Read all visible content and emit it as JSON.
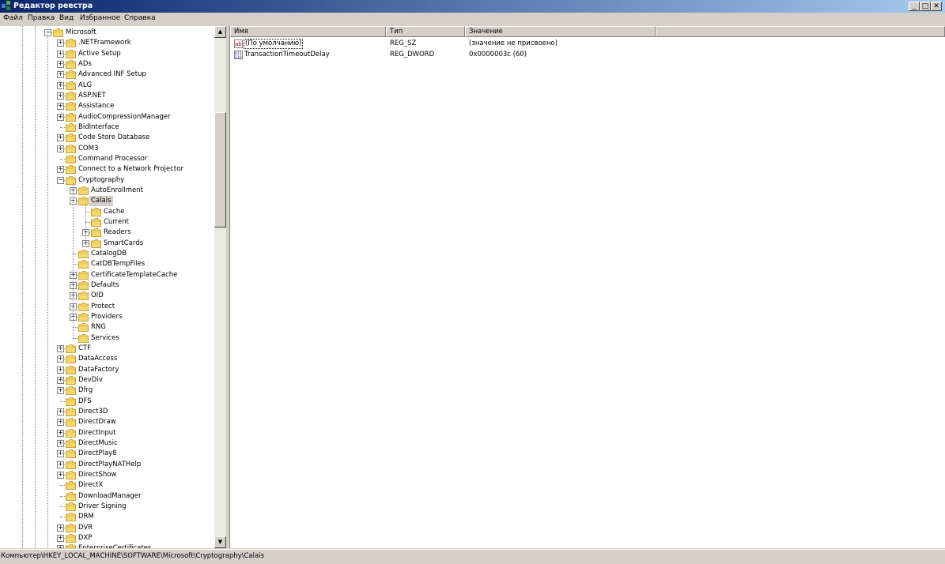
{
  "window": {
    "title": "Редактор реестра"
  },
  "menu": [
    "Файл",
    "Правка",
    "Вид",
    "Избранное",
    "Справка"
  ],
  "tree": {
    "root": {
      "label": "Microsoft"
    },
    "items": [
      {
        "label": ".NETFramework",
        "level": 1,
        "expandable": true
      },
      {
        "label": "Active Setup",
        "level": 1,
        "expandable": true
      },
      {
        "label": "ADs",
        "level": 1,
        "expandable": true
      },
      {
        "label": "Advanced INF Setup",
        "level": 1,
        "expandable": true
      },
      {
        "label": "ALG",
        "level": 1,
        "expandable": true
      },
      {
        "label": "ASP.NET",
        "level": 1,
        "expandable": true
      },
      {
        "label": "Assistance",
        "level": 1,
        "expandable": true
      },
      {
        "label": "AudioCompressionManager",
        "level": 1,
        "expandable": true
      },
      {
        "label": "BidInterface",
        "level": 1,
        "expandable": false
      },
      {
        "label": "Code Store Database",
        "level": 1,
        "expandable": true
      },
      {
        "label": "COM3",
        "level": 1,
        "expandable": true
      },
      {
        "label": "Command Processor",
        "level": 1,
        "expandable": false
      },
      {
        "label": "Connect to a Network Projector",
        "level": 1,
        "expandable": true
      },
      {
        "label": "Cryptography",
        "level": 1,
        "expandable": true,
        "expanded": true
      },
      {
        "label": "AutoEnrollment",
        "level": 2,
        "expandable": true
      },
      {
        "label": "Calais",
        "level": 2,
        "expandable": true,
        "expanded": true,
        "selected": true
      },
      {
        "label": "Cache",
        "level": 3,
        "expandable": false
      },
      {
        "label": "Current",
        "level": 3,
        "expandable": false
      },
      {
        "label": "Readers",
        "level": 3,
        "expandable": true
      },
      {
        "label": "SmartCards",
        "level": 3,
        "expandable": true
      },
      {
        "label": "CatalogDB",
        "level": 2,
        "expandable": false
      },
      {
        "label": "CatDBTempFiles",
        "level": 2,
        "expandable": false
      },
      {
        "label": "CertificateTemplateCache",
        "level": 2,
        "expandable": true
      },
      {
        "label": "Defaults",
        "level": 2,
        "expandable": true
      },
      {
        "label": "OID",
        "level": 2,
        "expandable": true
      },
      {
        "label": "Protect",
        "level": 2,
        "expandable": true
      },
      {
        "label": "Providers",
        "level": 2,
        "expandable": true
      },
      {
        "label": "RNG",
        "level": 2,
        "expandable": false
      },
      {
        "label": "Services",
        "level": 2,
        "expandable": false
      },
      {
        "label": "CTF",
        "level": 1,
        "expandable": true
      },
      {
        "label": "DataAccess",
        "level": 1,
        "expandable": true
      },
      {
        "label": "DataFactory",
        "level": 1,
        "expandable": true
      },
      {
        "label": "DevDiv",
        "level": 1,
        "expandable": true
      },
      {
        "label": "Dfrg",
        "level": 1,
        "expandable": true
      },
      {
        "label": "DFS",
        "level": 1,
        "expandable": false
      },
      {
        "label": "Direct3D",
        "level": 1,
        "expandable": true
      },
      {
        "label": "DirectDraw",
        "level": 1,
        "expandable": true
      },
      {
        "label": "DirectInput",
        "level": 1,
        "expandable": true
      },
      {
        "label": "DirectMusic",
        "level": 1,
        "expandable": true
      },
      {
        "label": "DirectPlay8",
        "level": 1,
        "expandable": true
      },
      {
        "label": "DirectPlayNATHelp",
        "level": 1,
        "expandable": true
      },
      {
        "label": "DirectShow",
        "level": 1,
        "expandable": true
      },
      {
        "label": "DirectX",
        "level": 1,
        "expandable": false
      },
      {
        "label": "DownloadManager",
        "level": 1,
        "expandable": false
      },
      {
        "label": "Driver Signing",
        "level": 1,
        "expandable": false
      },
      {
        "label": "DRM",
        "level": 1,
        "expandable": false
      },
      {
        "label": "DVR",
        "level": 1,
        "expandable": true
      },
      {
        "label": "DXP",
        "level": 1,
        "expandable": true
      },
      {
        "label": "EnterpriseCertificates",
        "level": 1,
        "expandable": true
      }
    ]
  },
  "list": {
    "columns": [
      "Имя",
      "Тип",
      "Значение"
    ],
    "rows": [
      {
        "name": "(По умолчанию)",
        "type": "REG_SZ",
        "value": "(значение не присвоено)",
        "icon": "string-value-icon"
      },
      {
        "name": "TransactionTimeoutDelay",
        "type": "REG_DWORD",
        "value": "0x0000003c (60)",
        "icon": "dword-value-icon"
      }
    ]
  },
  "status": {
    "path": "Компьютер\\HKEY_LOCAL_MACHINE\\SOFTWARE\\Microsoft\\Cryptography\\Calais"
  },
  "colors": {
    "titlebar_start": "#0a246a",
    "titlebar_end": "#a6caf0",
    "folder": "#f5d76e",
    "selection": "#d4d0c8"
  }
}
